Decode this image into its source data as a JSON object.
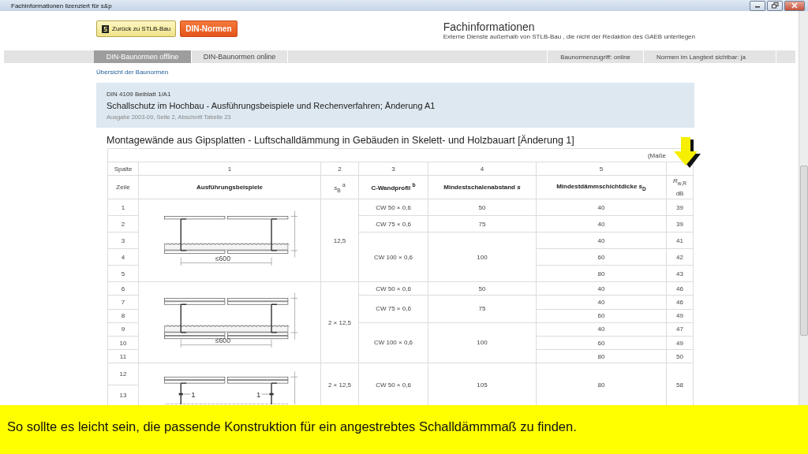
{
  "window": {
    "title": "Fachinformationen lizenziert für s&p"
  },
  "toolbar": {
    "buttons": [
      {
        "label": "Zurück zu STLB-Bau",
        "kind": "back"
      },
      {
        "label": "DIN-Normen",
        "kind": "primary"
      }
    ]
  },
  "header": {
    "title": "Fachinformationen",
    "subtitle": "Externe Dienste außerhalb von  STLB-Bau , die nicht der Redaktion des GAEB unterliegen"
  },
  "tabs": [
    {
      "label": "DIN-Baunormen offline",
      "selected": true
    },
    {
      "label": "DIN-Baunormen online",
      "selected": false
    }
  ],
  "status": [
    "Baunormenzugriff: online",
    "Normen im Langtext sichtbar: ja"
  ],
  "breadcrumb": "Übersicht der Baunormen",
  "norm": {
    "code": "DIN 4109 Beiblatt 1/A1",
    "title": "Schallschutz im Hochbau - Ausführungsbeispiele und Rechenverfahren; Änderung A1",
    "edition": "Ausgabe 2003-09, Seite 2, Abschnitt Tabelle 23"
  },
  "table": {
    "title": "Montagewände aus Gipsplatten - Luftschalldämmung in Gebäuden in Skelett- und Holzbauart [Änderung 1]",
    "note": "(Maße",
    "column_numbers": [
      "Spalte",
      "1",
      "2",
      "3",
      "4",
      "5"
    ],
    "headers": [
      "Zeile",
      "Ausführungsbeispiele",
      "*s*$_{B}$ $^{a}$",
      "C-Wandprofil $^{b}$",
      "Mindestschalenabstand *s*",
      "Mindestdämmschichtdicke *s*$_{D}$",
      "*R*$_{w,R}$"
    ],
    "unit": "dB",
    "groups": [
      {
        "sb": "12,5",
        "kind": "single",
        "dimension": "≤600",
        "profiles": [
          {
            "profile": "CW 50 × 0,6",
            "spacing": "50",
            "rows": [
              {
                "zeilen": [
                  "1"
                ],
                "insulation": "40",
                "rating": "39"
              }
            ]
          },
          {
            "profile": "CW 75 × 0,6",
            "spacing": "75",
            "rows": [
              {
                "zeilen": [
                  "2"
                ],
                "insulation": "40",
                "rating": "39"
              }
            ]
          },
          {
            "profile": "CW 100 × 0,6",
            "spacing": "100",
            "rows": [
              {
                "zeilen": [
                  "3"
                ],
                "insulation": "40",
                "rating": "41"
              },
              {
                "zeilen": [
                  "4"
                ],
                "insulation": "60",
                "rating": "42"
              },
              {
                "zeilen": [
                  "5"
                ],
                "insulation": "80",
                "rating": "43"
              }
            ]
          }
        ]
      },
      {
        "sb": "2 × 12,5",
        "kind": "double",
        "dimension": "≤600",
        "profiles": [
          {
            "profile": "CW 50 × 0,6",
            "spacing": "50",
            "rows": [
              {
                "zeilen": [
                  "6"
                ],
                "insulation": "40",
                "rating": "46"
              }
            ]
          },
          {
            "profile": "CW 75 × 0,6",
            "spacing": "75",
            "rows": [
              {
                "zeilen": [
                  "7"
                ],
                "insulation": "40",
                "rating": "46"
              },
              {
                "zeilen": [
                  "8"
                ],
                "insulation": "60",
                "rating": "49"
              }
            ]
          },
          {
            "profile": "CW 100 × 0,6",
            "spacing": "100",
            "rows": [
              {
                "zeilen": [
                  "9"
                ],
                "insulation": "40",
                "rating": "47"
              },
              {
                "zeilen": [
                  "10"
                ],
                "insulation": "60",
                "rating": "49"
              },
              {
                "zeilen": [
                  "11"
                ],
                "insulation": "80",
                "rating": "50"
              }
            ]
          }
        ]
      },
      {
        "sb": "2 × 12,5",
        "kind": "double",
        "markers": [
          "1",
          "1"
        ],
        "profiles": [
          {
            "profile": "CW 50 × 0,6",
            "spacing": "105",
            "rows": [
              {
                "zeilen": [
                  "12",
                  "13"
                ],
                "insulation": "80",
                "rating": "58"
              }
            ]
          }
        ]
      }
    ]
  },
  "caption": "So sollte es leicht sein, die passende Konstruktion für ein angestrebtes Schalldämmmaß zu finden."
}
